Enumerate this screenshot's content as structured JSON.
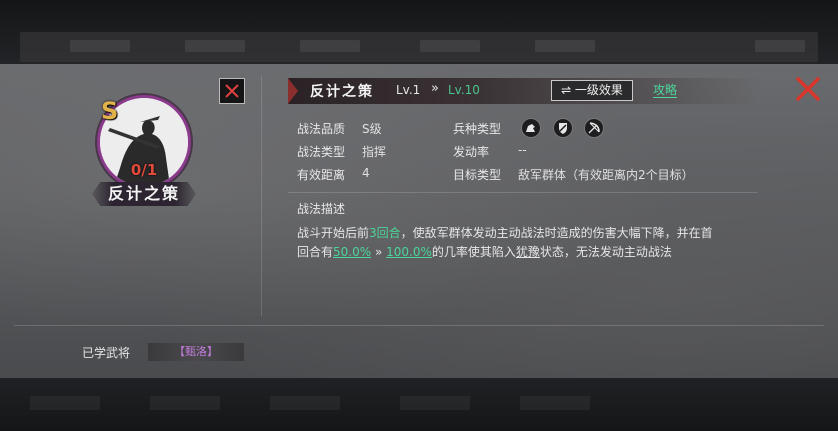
{
  "skill": {
    "grade_letter": "S",
    "owned_count": "0/1",
    "name": "反计之策",
    "level_current": "Lv.1",
    "level_arrow": "»",
    "level_max": "Lv.10",
    "effect_button": "⇌ 一级效果",
    "strategy_link": "攻略"
  },
  "info": {
    "quality_label": "战法品质",
    "quality_value": "S级",
    "type_label": "战法类型",
    "type_value": "指挥",
    "range_label": "有效距离",
    "range_value": "4",
    "troop_label": "兵种类型",
    "trigger_label": "发动率",
    "trigger_value": "--",
    "target_label": "目标类型",
    "target_value": "敌军群体（有效距离内2个目标）",
    "troop_icons": [
      "cavalry-icon",
      "shield-icon",
      "bow-icon"
    ]
  },
  "description": {
    "title": "战法描述",
    "part1": "战斗开始后前",
    "turns": "3回合",
    "part2": "，使敌军群体发动主动战法时造成的伤害大幅下降，并在首",
    "part3": "回合有",
    "rate_min": "50.0%",
    "arrow": " » ",
    "rate_max": "100.0%",
    "part4": "的几率使其陷入",
    "status": "犹豫",
    "part5": "状态，无法发动主动战法"
  },
  "learned": {
    "label": "已学武将",
    "general": "【甄洛】"
  },
  "colors": {
    "accent_green": "#4cd69a",
    "grade_gold": "#e2b24a",
    "count_red": "#e24a3b",
    "close_red": "#d9352b",
    "portrait_ring": "#8b3b8c"
  }
}
